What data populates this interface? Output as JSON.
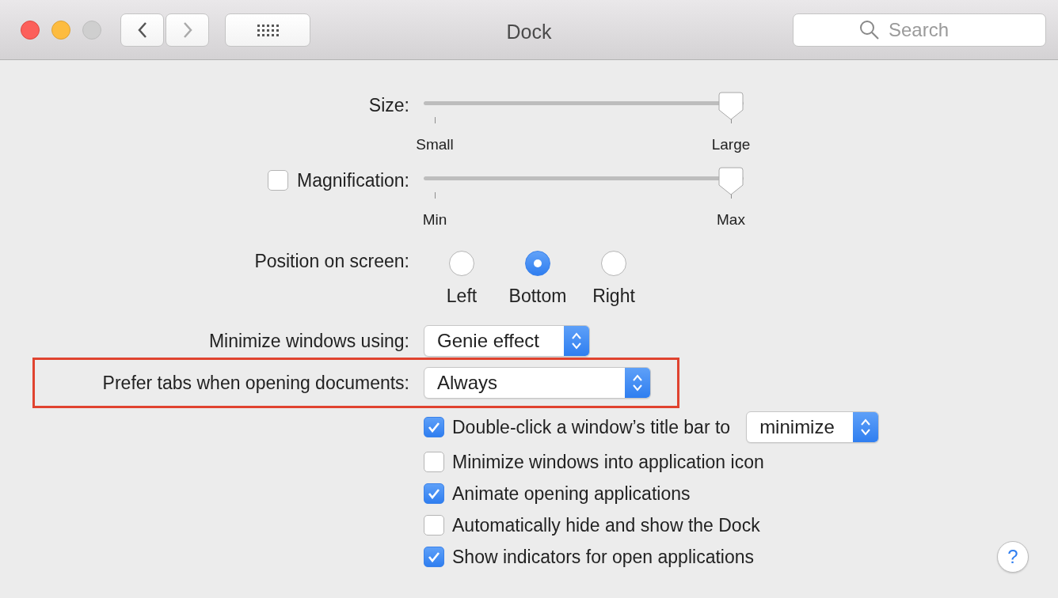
{
  "window": {
    "title": "Dock"
  },
  "search": {
    "placeholder": "Search"
  },
  "settings": [
    {
      "kind": "slider",
      "label": "Size:",
      "level": 1,
      "min_label": "Small",
      "max_label": "Large"
    },
    {
      "kind": "slider",
      "label": "Magnification:",
      "checked": false,
      "level": 1,
      "min_label": "Min",
      "max_label": "Max"
    },
    {
      "kind": "radio",
      "label": "Position on screen:",
      "options": [
        {
          "label": "Left",
          "selected": false
        },
        {
          "label": "Bottom",
          "selected": true
        },
        {
          "label": "Right",
          "selected": false
        }
      ]
    },
    {
      "kind": "popup",
      "label": "Minimize windows using:",
      "value": "Genie effect",
      "highlighted": false
    },
    {
      "kind": "popup",
      "label": "Prefer tabs when opening documents:",
      "value": "Always",
      "highlighted": true
    }
  ],
  "options": [
    {
      "label": "Double-click a window’s title bar to",
      "checked": true,
      "popup": "minimize"
    },
    {
      "label": "Minimize windows into application icon",
      "checked": false
    },
    {
      "label": "Animate opening applications",
      "checked": true
    },
    {
      "label": "Automatically hide and show the Dock",
      "checked": false
    },
    {
      "label": "Show indicators for open applications",
      "checked": true
    }
  ],
  "help_button": {
    "label": "?"
  }
}
